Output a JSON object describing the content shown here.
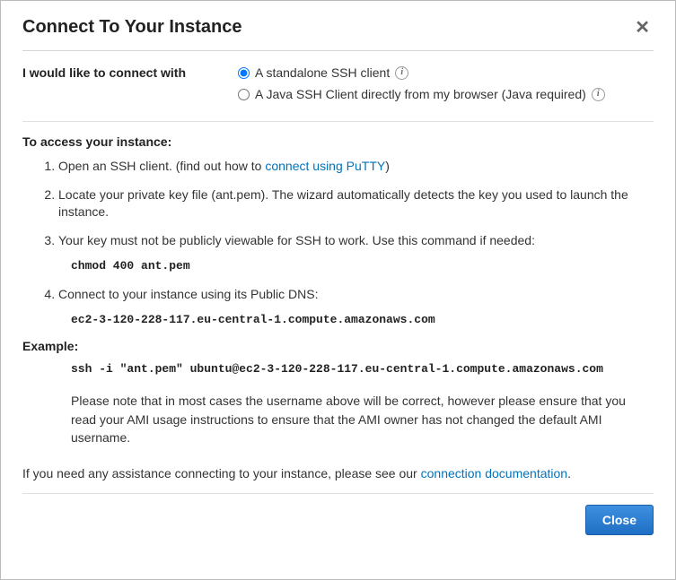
{
  "dialog": {
    "title": "Connect To Your Instance",
    "close_button": "Close"
  },
  "connect": {
    "label": "I would like to connect with",
    "opt1": "A standalone SSH client",
    "opt2": "A Java SSH Client directly from my browser (Java required)"
  },
  "access": {
    "heading": "To access your instance:",
    "step1_pre": "Open an SSH client. (find out how to ",
    "step1_link": "connect using PuTTY",
    "step1_post": ")",
    "step2": "Locate your private key file (ant.pem). The wizard automatically detects the key you used to launch the instance.",
    "step3": "Your key must not be publicly viewable for SSH to work. Use this command if needed:",
    "step3_cmd": "chmod 400 ant.pem",
    "step4": "Connect to your instance using its Public DNS:",
    "step4_dns": "ec2-3-120-228-117.eu-central-1.compute.amazonaws.com"
  },
  "example": {
    "heading": "Example:",
    "cmd": "ssh -i \"ant.pem\" ubuntu@ec2-3-120-228-117.eu-central-1.compute.amazonaws.com",
    "note": "Please note that in most cases the username above will be correct, however please ensure that you read your AMI usage instructions to ensure that the AMI owner has not changed the default AMI username."
  },
  "assist": {
    "pre": "If you need any assistance connecting to your instance, please see our ",
    "link": "connection documentation",
    "post": "."
  }
}
